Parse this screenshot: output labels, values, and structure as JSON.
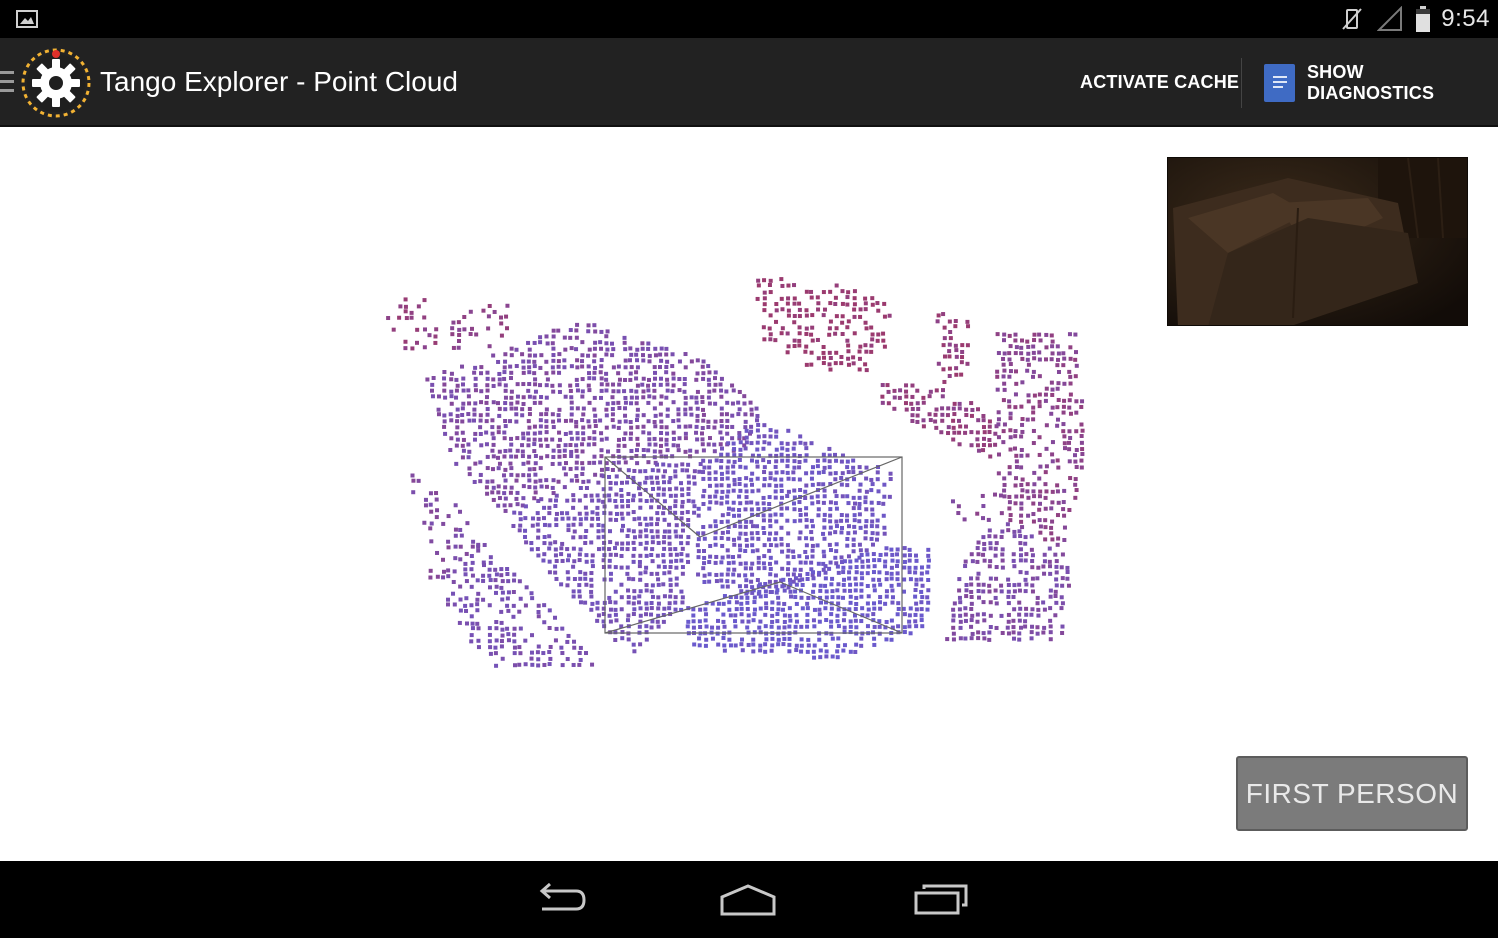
{
  "status_bar": {
    "time": "9:54",
    "icons": [
      "image-notification-icon",
      "vibrate-off-icon",
      "no-signal-icon",
      "battery-icon"
    ]
  },
  "action_bar": {
    "title": "Tango Explorer - Point Cloud",
    "activate_cache_label": "ACTIVATE CACHE",
    "show_diagnostics_label": "SHOW DIAGNOSTICS",
    "icons": [
      "menu-icon",
      "app-gear-logo-icon",
      "document-icon"
    ]
  },
  "main": {
    "first_person_label": "FIRST PERSON",
    "colors": {
      "cloud_near": "#6a5acd",
      "cloud_mid": "#7a4fae",
      "cloud_far": "#9b3a6e"
    }
  },
  "nav_bar": {
    "icons": [
      "back-icon",
      "home-icon",
      "recent-apps-icon"
    ]
  }
}
